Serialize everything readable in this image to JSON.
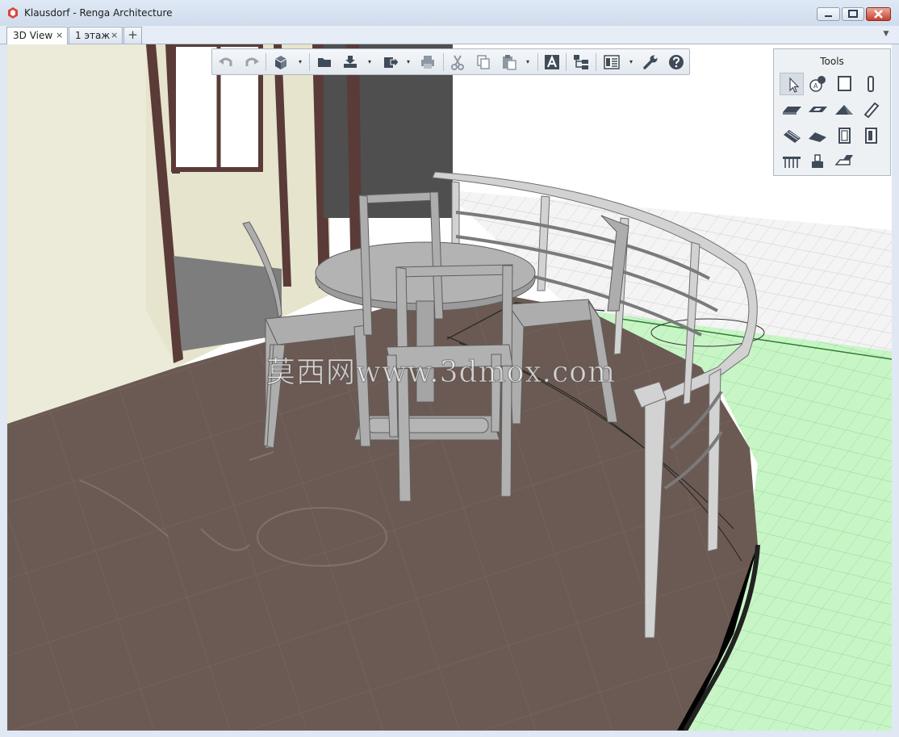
{
  "window": {
    "title": "Klausdorf - Renga Architecture"
  },
  "tabs": [
    {
      "label": "3D View",
      "close": "×"
    },
    {
      "label": "1 этаж",
      "close": "×"
    }
  ],
  "tab_add": "+",
  "tab_menu": "▼",
  "toolbar": {
    "buttons": [
      "undo-icon",
      "redo-icon",
      "view-cube-icon",
      "open-folder-icon",
      "import-icon",
      "export-icon",
      "print-icon",
      "cut-icon",
      "copy-icon",
      "paste-icon",
      "text-style-icon",
      "hierarchy-icon",
      "properties-icon",
      "settings-wrench-icon",
      "help-icon"
    ],
    "dropdown_glyph": "▾"
  },
  "tools_panel": {
    "title": "Tools",
    "items": [
      "select-icon",
      "axis-icon",
      "wall-icon",
      "column-icon",
      "floor-icon",
      "opening-icon",
      "roof-icon",
      "beam-icon",
      "stair-icon",
      "ramp-icon",
      "window-icon",
      "door-icon",
      "railing-icon",
      "equipment-icon",
      "element-icon"
    ]
  },
  "watermark": "莫西网www.3dmox.com",
  "colors": {
    "floor": "#6b5a53",
    "ground_grid": "#c8f5c6",
    "furniture": "#a8a8a8",
    "wall": "#ecebd9",
    "frame": "#5a3b38"
  }
}
